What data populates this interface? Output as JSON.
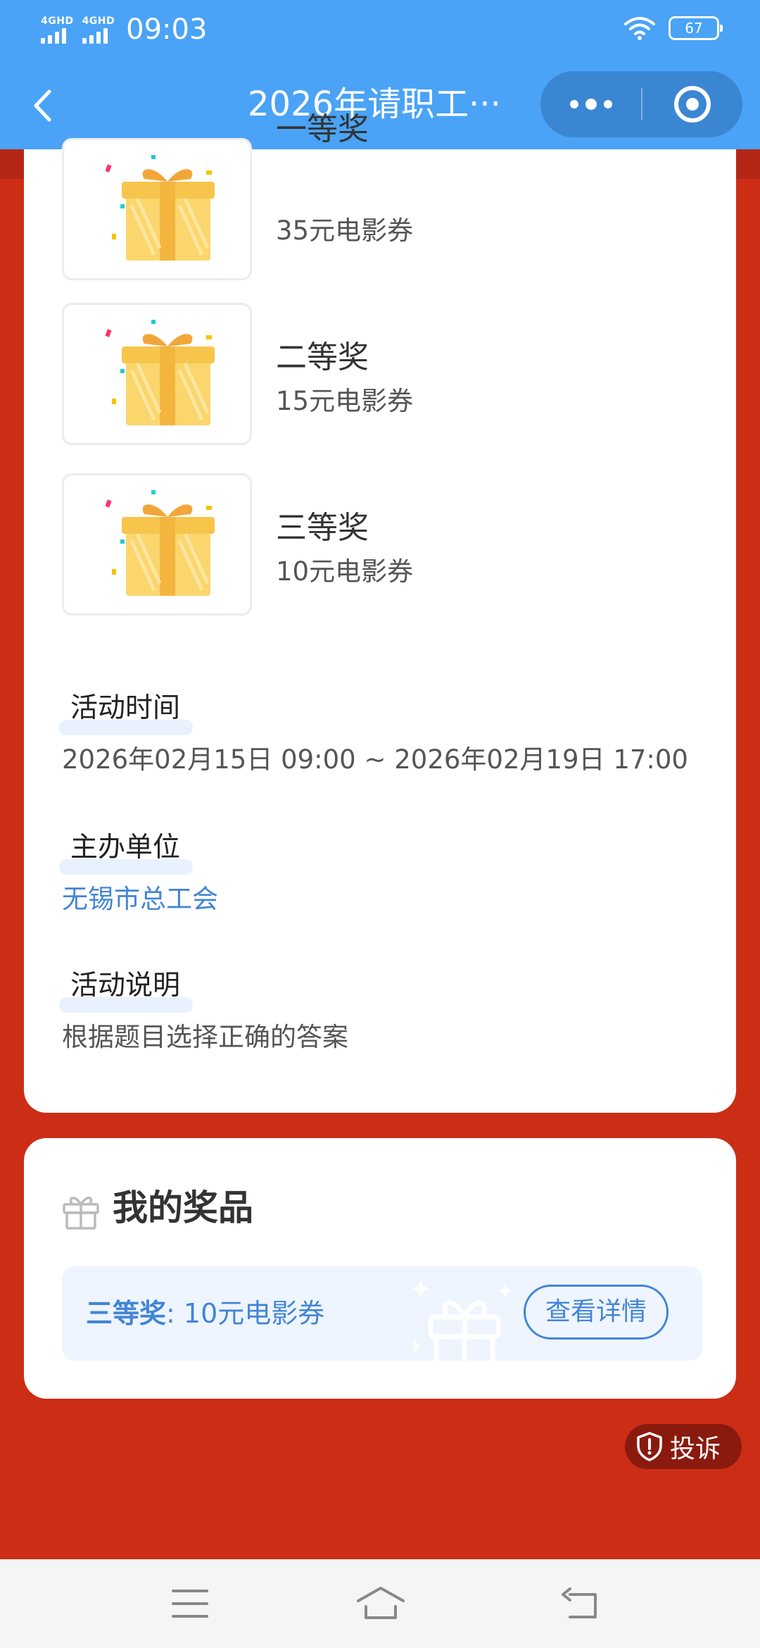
{
  "status_bar": {
    "network_1": "4GHD",
    "network_2": "4GHD",
    "time": "09:03",
    "battery": "67"
  },
  "nav": {
    "title": "2026年请职工···"
  },
  "prizes": [
    {
      "name": "一等奖",
      "desc": "35元电影券"
    },
    {
      "name": "二等奖",
      "desc": "15元电影券"
    },
    {
      "name": "三等奖",
      "desc": "10元电影券"
    }
  ],
  "sections": {
    "time": {
      "title": "活动时间",
      "value": "2026年02月15日 09:00 ~ 2026年02月19日 17:00"
    },
    "organizer": {
      "title": "主办单位",
      "value": "无锡市总工会"
    },
    "description": {
      "title": "活动说明",
      "value": "根据题目选择正确的答案"
    }
  },
  "my_prize": {
    "title": "我的奖品",
    "prize_level": "三等奖",
    "separator": ": ",
    "prize_desc": "10元电影券",
    "detail_button": "查看详情"
  },
  "complaint": {
    "label": "投诉"
  },
  "colors": {
    "header_blue": "#4aa3f6",
    "page_red": "#cb2e15",
    "accent_blue": "#4385d6"
  }
}
